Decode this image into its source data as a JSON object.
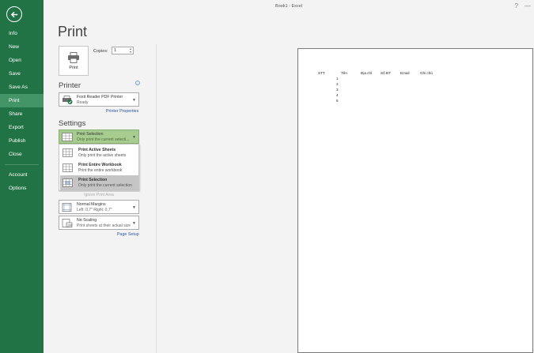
{
  "window": {
    "title": "Book1 - Excel",
    "help": "?",
    "minimize": "—"
  },
  "sidebar": {
    "items": [
      {
        "label": "Info"
      },
      {
        "label": "New"
      },
      {
        "label": "Open"
      },
      {
        "label": "Save"
      },
      {
        "label": "Save As"
      },
      {
        "label": "Print"
      },
      {
        "label": "Share"
      },
      {
        "label": "Export"
      },
      {
        "label": "Publish"
      },
      {
        "label": "Close"
      },
      {
        "label": "Account"
      },
      {
        "label": "Options"
      }
    ],
    "active": "Print"
  },
  "print": {
    "heading": "Print",
    "button_label": "Print",
    "copies_label": "Copies:",
    "copies_value": "1"
  },
  "printer": {
    "section_title": "Printer",
    "name": "Foxit Reader PDF Printer",
    "status": "Ready",
    "properties_link": "Printer Properties",
    "info_icon": "i"
  },
  "settings": {
    "section_title": "Settings",
    "selected": {
      "title": "Print Selection",
      "desc": "Only print the current selecti..."
    },
    "options": [
      {
        "title": "Print Active Sheets",
        "desc": "Only print the active sheets"
      },
      {
        "title": "Print Entire Workbook",
        "desc": "Print the entire workbook"
      },
      {
        "title": "Print Selection",
        "desc": "Only print the current selection"
      }
    ],
    "ignore_print_area": "Ignore Print Area",
    "margins": {
      "title": "Normal Margins",
      "desc": "Left: 0,7\"   Right: 0,7\""
    },
    "scaling": {
      "title": "No Scaling",
      "desc": "Print sheets at their actual size"
    },
    "page_setup_link": "Page Setup"
  },
  "preview": {
    "headers": [
      "STT",
      "Tên",
      "Địa chỉ",
      "Số ĐT",
      "Email",
      "Ghi chú"
    ],
    "rows": [
      "1",
      "2",
      "3",
      "4",
      "5"
    ]
  },
  "colors": {
    "accent": "#217346",
    "selected": "#a6cd8f"
  }
}
